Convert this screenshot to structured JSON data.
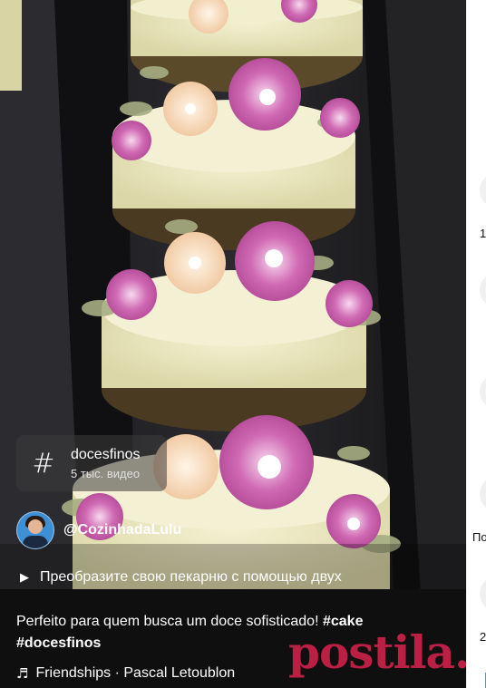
{
  "hashtag_chip": {
    "symbol": "#",
    "tag": "docesfinos",
    "count": "5 тыс. видео"
  },
  "channel": {
    "handle": "@CozinhadaLulu"
  },
  "promo": {
    "play_icon": "▶",
    "text": "Преобразите свою пекарню с помощью двух"
  },
  "caption": {
    "text": "Perfeito para quem busca um doce sofisticado!",
    "tags": [
      "#cake",
      "#docesfinos"
    ]
  },
  "music": {
    "icon": "music-note-icon",
    "track": "Friendships · Pascal Letoublon"
  },
  "watermark": {
    "text": "postila.ru"
  },
  "right_panel": {
    "label_1": "1",
    "label_2": "По",
    "label_3": "2"
  },
  "colors": {
    "overlay_chip": "#3c3c3c",
    "bottom_bar": "#0f0f0f",
    "watermark": "#ec2452",
    "accent_blue": "#2aa1e0"
  }
}
